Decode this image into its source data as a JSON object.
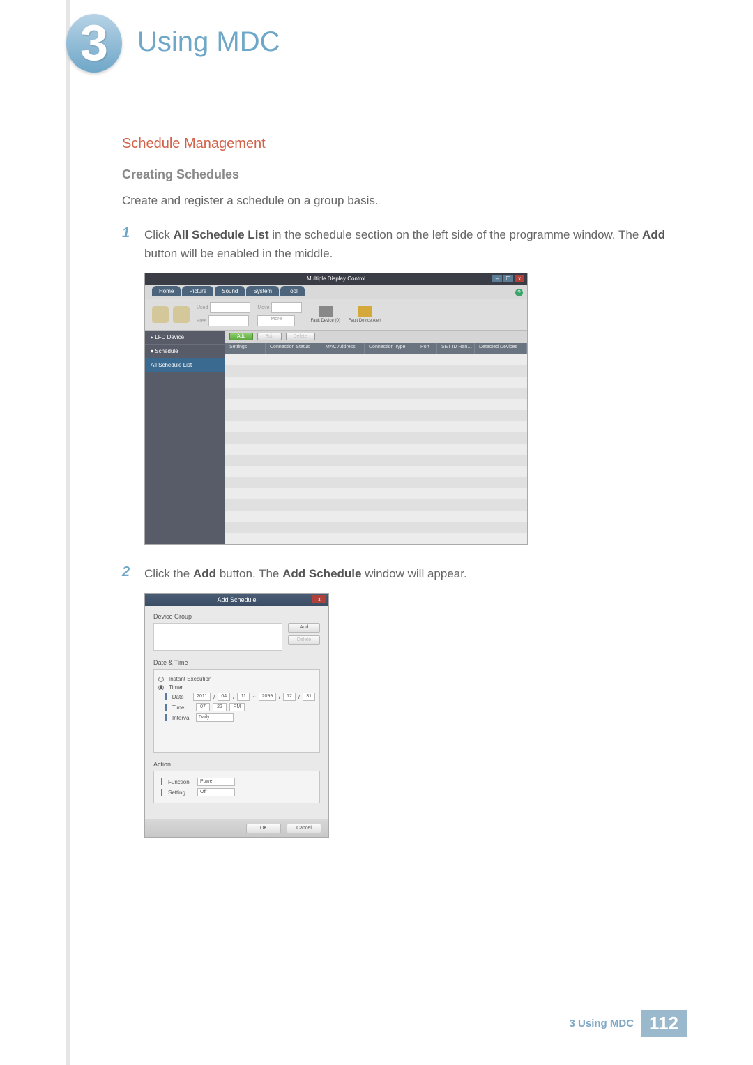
{
  "chapter": {
    "number": "3",
    "title": "Using MDC"
  },
  "section": {
    "title": "Schedule Management"
  },
  "subsection": {
    "title": "Creating Schedules"
  },
  "intro_text": "Create and register a schedule on a group basis.",
  "steps": [
    {
      "num": "1",
      "pre": "Click ",
      "bold1": "All Schedule List",
      "mid": " in the schedule section on the left side of the programme window. The ",
      "bold2": "Add",
      "post": " button will be enabled in the middle."
    },
    {
      "num": "2",
      "pre": "Click the ",
      "bold1": "Add",
      "mid": " button. The ",
      "bold2": "Add Schedule",
      "post": " window will appear."
    }
  ],
  "shot1": {
    "title": "Multiple Display Control",
    "help": "?",
    "tabs": [
      "Home",
      "Picture",
      "Sound",
      "System",
      "Tool"
    ],
    "toolbar": {
      "used": "Used",
      "free": "Free",
      "move": "Move",
      "more": "More",
      "fault_device": "Fault Device (0)",
      "fault_alert": "Fault Device Alert"
    },
    "left": {
      "lfd": "▸ LFD Device",
      "schedule": "▾ Schedule",
      "all": "All Schedule List"
    },
    "actions": {
      "add": "Add",
      "edit": "Edit",
      "delete": "Delete"
    },
    "columns": [
      "Settings",
      "Connection Status",
      "MAC Address",
      "Connection Type",
      "Port",
      "SET ID Ran…",
      "Detected Devices"
    ]
  },
  "shot2": {
    "title": "Add Schedule",
    "device_group": "Device Group",
    "add": "Add",
    "delete": "Delete",
    "date_time": "Date & Time",
    "instant": "Instant Execution",
    "timer": "Timer",
    "date_label": "Date",
    "date_vals": {
      "y1": "2011",
      "m1": "04",
      "d1": "11",
      "sep": "~",
      "y2": "2099",
      "m2": "12",
      "d2": "31"
    },
    "time_label": "Time",
    "time_vals": {
      "h": "07",
      "m": "22",
      "ap": "PM"
    },
    "interval_label": "Interval",
    "interval_val": "Daily",
    "action": "Action",
    "function_label": "Function",
    "function_val": "Power",
    "setting_label": "Setting",
    "setting_val": "Off",
    "ok": "OK",
    "cancel": "Cancel"
  },
  "footer": {
    "label": "3 Using MDC",
    "page": "112"
  }
}
